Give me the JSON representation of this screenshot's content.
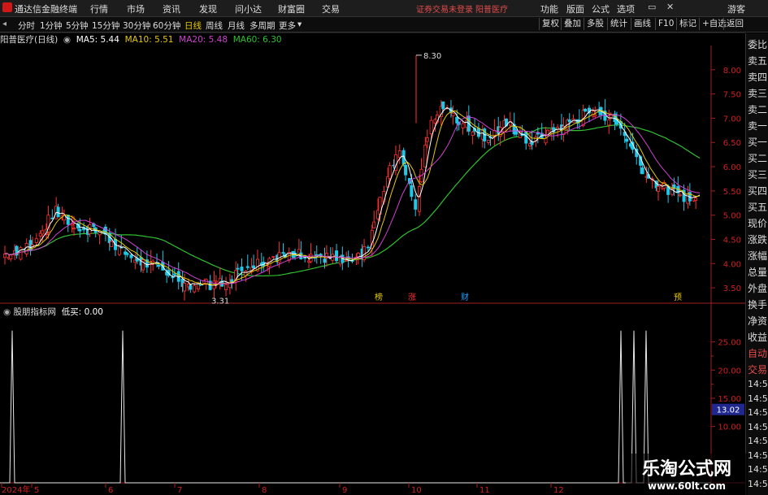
{
  "app": {
    "title": "通达信金融终端"
  },
  "menu": [
    "行情",
    "市场",
    "资讯",
    "发现",
    "问小达",
    "财富圈",
    "交易"
  ],
  "notice": "证券交易未登录",
  "stock_name": "阳普医疗",
  "right_menu": [
    "功能",
    "版面",
    "公式",
    "选项"
  ],
  "guest": "游客",
  "periods": [
    "分时",
    "1分钟",
    "5分钟",
    "15分钟",
    "30分钟",
    "60分钟",
    "日线",
    "周线",
    "月线",
    "多周期",
    "更多"
  ],
  "active_period": "日线",
  "tools": [
    "复权",
    "叠加",
    "多股",
    "统计",
    "画线",
    "F10",
    "标记",
    "+自选",
    "返回"
  ],
  "main_title": "阳普医疗(日线)",
  "ma": [
    {
      "label": "MA5: 5.44",
      "color": "#ffffff"
    },
    {
      "label": "MA10: 5.51",
      "color": "#e6c800"
    },
    {
      "label": "MA20: 5.48",
      "color": "#d040d0"
    },
    {
      "label": "MA60: 6.30",
      "color": "#30c030"
    }
  ],
  "price_axis": [
    "8.00",
    "7.50",
    "7.00",
    "6.50",
    "6.00",
    "5.50",
    "5.00",
    "4.50",
    "4.00",
    "3.50"
  ],
  "high_label": "8.30",
  "low_label": "3.31",
  "event_markers": [
    "榜",
    "涨",
    "财",
    "预"
  ],
  "indicator": {
    "name": "股朋指标网",
    "value_label": "低买: 0.00"
  },
  "indicator_axis": [
    "25.00",
    "20.00",
    "15.00",
    "10.00"
  ],
  "current_value": "13.02",
  "x_axis": [
    "2024年",
    "5",
    "6",
    "7",
    "8",
    "9",
    "10",
    "11",
    "12"
  ],
  "side_labels": [
    "委比",
    "卖五",
    "卖四",
    "卖三",
    "卖二",
    "卖一",
    "买一",
    "买二",
    "买三",
    "买四",
    "买五",
    "现价",
    "涨跌",
    "涨幅",
    "总量",
    "外盘",
    "换手",
    "净资",
    "收益",
    "自动",
    "交易"
  ],
  "times": [
    "14:56",
    "14:56",
    "14:56",
    "14:56",
    "14:56",
    "14:56",
    "14:56",
    "14:56"
  ],
  "watermark": {
    "title": "乐淘公式网",
    "url": "www.60lt.com"
  },
  "chart_data": {
    "type": "candlestick",
    "ylim": [
      3.2,
      8.5
    ],
    "months": [
      "5",
      "6",
      "7",
      "8",
      "9",
      "10",
      "11",
      "12"
    ],
    "high": 8.3,
    "low": 3.31,
    "ma_values": {
      "MA5": 5.44,
      "MA10": 5.51,
      "MA20": 5.48,
      "MA60": 6.3
    },
    "indicator_values": [
      27,
      0,
      27,
      0,
      27,
      27,
      27
    ]
  }
}
